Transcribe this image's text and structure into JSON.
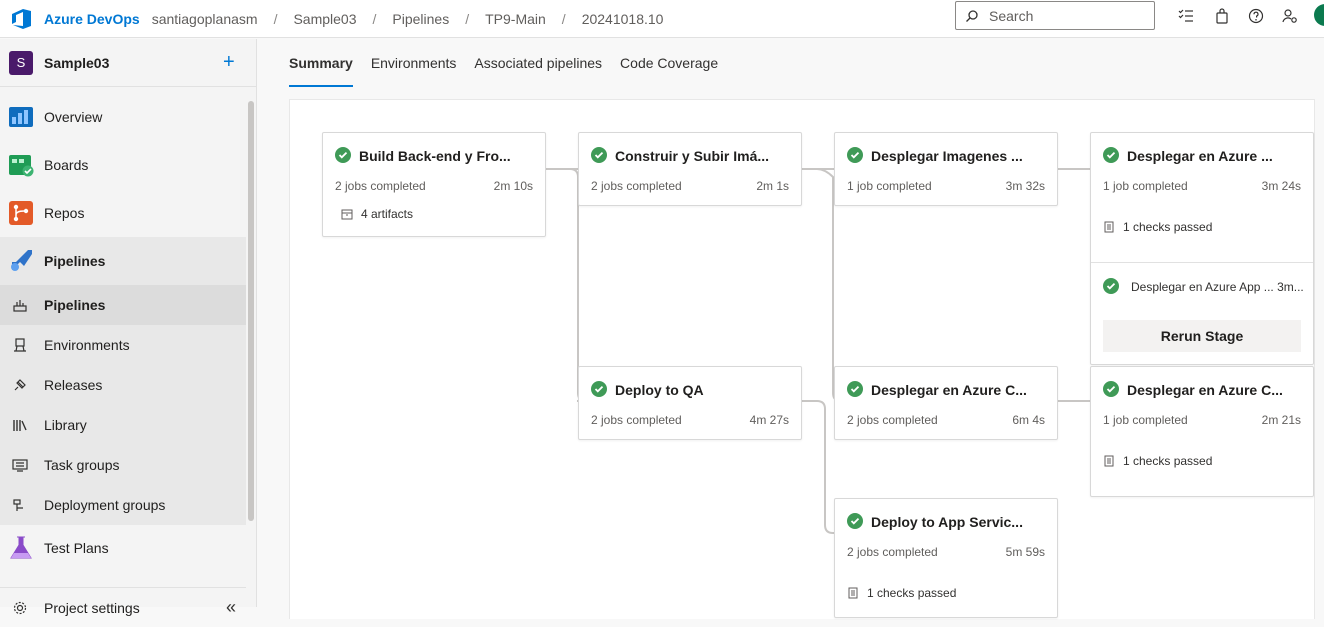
{
  "header": {
    "brand": "Azure DevOps",
    "org": "santiagoplanasm",
    "sep": "/",
    "breadcrumbs": [
      "Sample03",
      "Pipelines",
      "TP9-Main",
      "20241018.10"
    ],
    "search_placeholder": "Search",
    "icons": [
      "task-list-icon",
      "shopping-bag-icon",
      "help-icon",
      "user-settings-icon"
    ]
  },
  "sidebar": {
    "project_initial": "S",
    "project_name": "Sample03",
    "add_label": "+",
    "collapse_label": "«",
    "items": [
      {
        "label": "Overview",
        "icon": "overview-icon"
      },
      {
        "label": "Boards",
        "icon": "boards-icon"
      },
      {
        "label": "Repos",
        "icon": "repos-icon"
      },
      {
        "label": "Pipelines",
        "icon": "pipelines-icon"
      },
      {
        "label": "Pipelines",
        "icon": "pipelines-sub-icon"
      },
      {
        "label": "Environments",
        "icon": "environments-icon"
      },
      {
        "label": "Releases",
        "icon": "releases-icon"
      },
      {
        "label": "Library",
        "icon": "library-icon"
      },
      {
        "label": "Task groups",
        "icon": "task-groups-icon"
      },
      {
        "label": "Deployment groups",
        "icon": "deployment-groups-icon"
      },
      {
        "label": "Test Plans",
        "icon": "test-plans-icon"
      },
      {
        "label": "Project settings",
        "icon": "gear-icon"
      }
    ]
  },
  "tabs": [
    "Summary",
    "Environments",
    "Associated pipelines",
    "Code Coverage"
  ],
  "stages": [
    {
      "title": "Build Back-end y Fro...",
      "jobs": "2 jobs completed",
      "duration": "2m 10s",
      "extra": "4 artifacts"
    },
    {
      "title": "Construir y Subir Imá...",
      "jobs": "2 jobs completed",
      "duration": "2m 1s"
    },
    {
      "title": "Desplegar Imagenes ...",
      "jobs": "1 job completed",
      "duration": "3m 32s"
    },
    {
      "title": "Desplegar en Azure ...",
      "jobs": "1 job completed",
      "duration": "3m 24s",
      "extra": "1 checks passed",
      "job_line": "Desplegar en Azure App ... 3m...",
      "rerun_label": "Rerun Stage"
    },
    {
      "title": "Deploy to QA",
      "jobs": "2 jobs completed",
      "duration": "4m 27s"
    },
    {
      "title": "Desplegar en Azure C...",
      "jobs": "2 jobs completed",
      "duration": "6m 4s"
    },
    {
      "title": "Desplegar en Azure C...",
      "jobs": "1 job completed",
      "duration": "2m 21s",
      "extra": "1 checks passed"
    },
    {
      "title": "Deploy to App Servic...",
      "jobs": "2 jobs completed",
      "duration": "5m 59s",
      "extra": "1 checks passed"
    }
  ],
  "colors": {
    "accent": "#0078d4",
    "success": "#3f9a57"
  }
}
